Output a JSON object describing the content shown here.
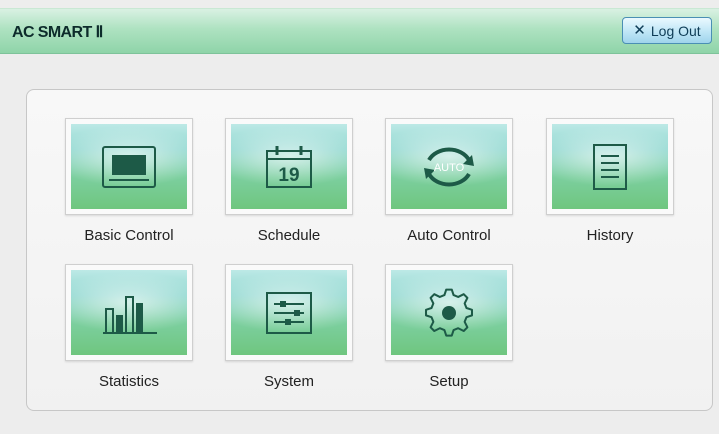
{
  "app": {
    "title": "AC SMART Ⅱ"
  },
  "header": {
    "logout_icon": "✕",
    "logout_label": "Log Out"
  },
  "menu": {
    "items": [
      {
        "label": "Basic Control",
        "icon": "monitor-icon"
      },
      {
        "label": "Schedule",
        "icon": "calendar-icon",
        "icon_text": "19"
      },
      {
        "label": "Auto Control",
        "icon": "auto-cycle-icon",
        "icon_text": "AUTO"
      },
      {
        "label": "History",
        "icon": "document-list-icon"
      },
      {
        "label": "Statistics",
        "icon": "bar-chart-icon"
      },
      {
        "label": "System",
        "icon": "sliders-icon"
      },
      {
        "label": "Setup",
        "icon": "gear-icon"
      }
    ]
  },
  "colors": {
    "icon_stroke": "#1d5a47",
    "title_gradient_top": "#d9f1e3",
    "title_gradient_bottom": "#8fd4a9"
  }
}
